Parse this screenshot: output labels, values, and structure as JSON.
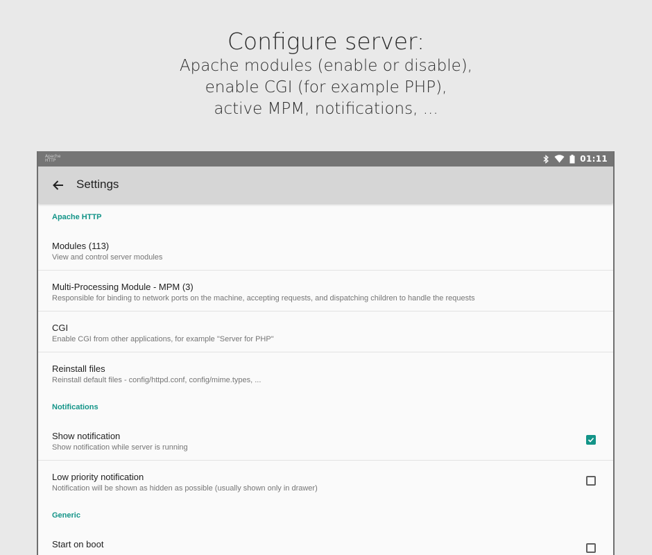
{
  "promo": {
    "headline": "Configure server:",
    "lines": [
      "Apache modules (enable or disable),",
      "enable CGI (for example PHP),",
      "active MPM, notifications, ..."
    ]
  },
  "statusbar": {
    "app_icon_text": "Apache HTTP",
    "icons": [
      "bluetooth-icon",
      "wifi-icon",
      "battery-icon"
    ],
    "time": "01:11"
  },
  "toolbar": {
    "back_icon": "arrow-left-icon",
    "title": "Settings"
  },
  "colors": {
    "accent": "#139488",
    "toolbar_bg": "#d6d6d6",
    "statusbar_bg": "#757575"
  },
  "sections": [
    {
      "title": "Apache HTTP",
      "items": [
        {
          "title": "Modules (113)",
          "summary": "View and control server modules"
        },
        {
          "title": "Multi-Processing Module - MPM (3)",
          "summary": "Responsible for binding to network ports on the machine, accepting requests, and dispatching children to handle the requests"
        },
        {
          "title": "CGI",
          "summary": "Enable CGI from other applications, for example \"Server for PHP\""
        },
        {
          "title": "Reinstall files",
          "summary": "Reinstall default files - config/httpd.conf, config/mime.types, ..."
        }
      ]
    },
    {
      "title": "Notifications",
      "items": [
        {
          "title": "Show notification",
          "summary": "Show notification while server is running",
          "checked": true
        },
        {
          "title": "Low priority notification",
          "summary": "Notification will be shown as hidden as possible (usually shown only in drawer)",
          "checked": false
        }
      ]
    },
    {
      "title": "Generic",
      "items": [
        {
          "title": "Start on boot",
          "summary": "",
          "checked": false
        }
      ]
    }
  ]
}
